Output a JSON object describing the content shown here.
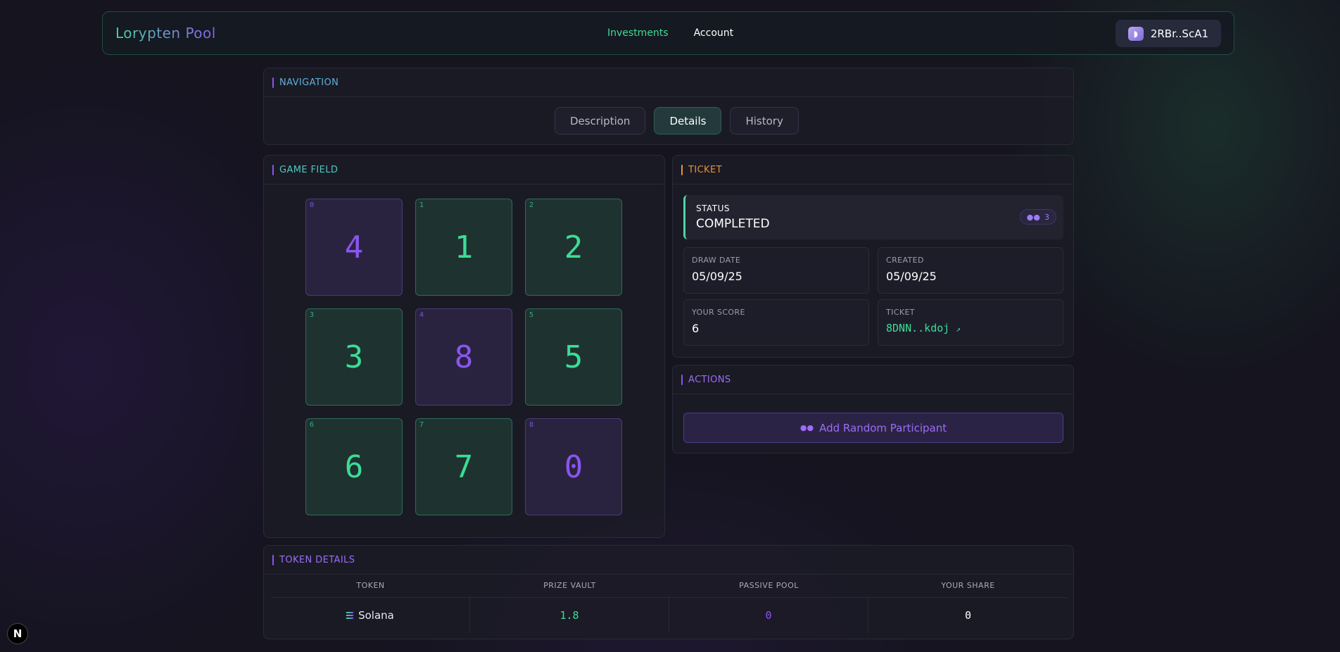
{
  "header": {
    "brand": "Lorypten Pool",
    "nav": [
      "Investments",
      "Account"
    ],
    "wallet": "2RBr..ScA1"
  },
  "navigation": {
    "title": "NAVIGATION",
    "tabs": [
      "Description",
      "Details",
      "History"
    ],
    "active_tab": "Details"
  },
  "game_field": {
    "title": "GAME FIELD",
    "cells": [
      {
        "index": "0",
        "value": "4",
        "color": "purple"
      },
      {
        "index": "1",
        "value": "1",
        "color": "green"
      },
      {
        "index": "2",
        "value": "2",
        "color": "green"
      },
      {
        "index": "3",
        "value": "3",
        "color": "green"
      },
      {
        "index": "4",
        "value": "8",
        "color": "purple"
      },
      {
        "index": "5",
        "value": "5",
        "color": "green"
      },
      {
        "index": "6",
        "value": "6",
        "color": "green"
      },
      {
        "index": "7",
        "value": "7",
        "color": "green"
      },
      {
        "index": "8",
        "value": "0",
        "color": "purple"
      }
    ]
  },
  "ticket": {
    "title": "TICKET",
    "status_label": "STATUS",
    "status_value": "COMPLETED",
    "participants": "3",
    "draw_date_label": "DRAW DATE",
    "draw_date": "05/09/25",
    "created_label": "CREATED",
    "created": "05/09/25",
    "score_label": "YOUR SCORE",
    "score": "6",
    "ticket_label": "TICKET",
    "ticket_id": "8DNN..kdoj"
  },
  "actions": {
    "title": "ACTIONS",
    "add_participant": "Add Random Participant"
  },
  "token_details": {
    "title": "TOKEN DETAILS",
    "columns": [
      "TOKEN",
      "PRIZE VAULT",
      "PASSIVE POOL",
      "YOUR SHARE"
    ],
    "row": {
      "token": "Solana",
      "prize_vault": "1.8",
      "passive_pool": "0",
      "your_share": "0"
    }
  },
  "colors": {
    "green": "#3ddc97",
    "purple": "#8a55f0",
    "orange": "#e8923a"
  }
}
